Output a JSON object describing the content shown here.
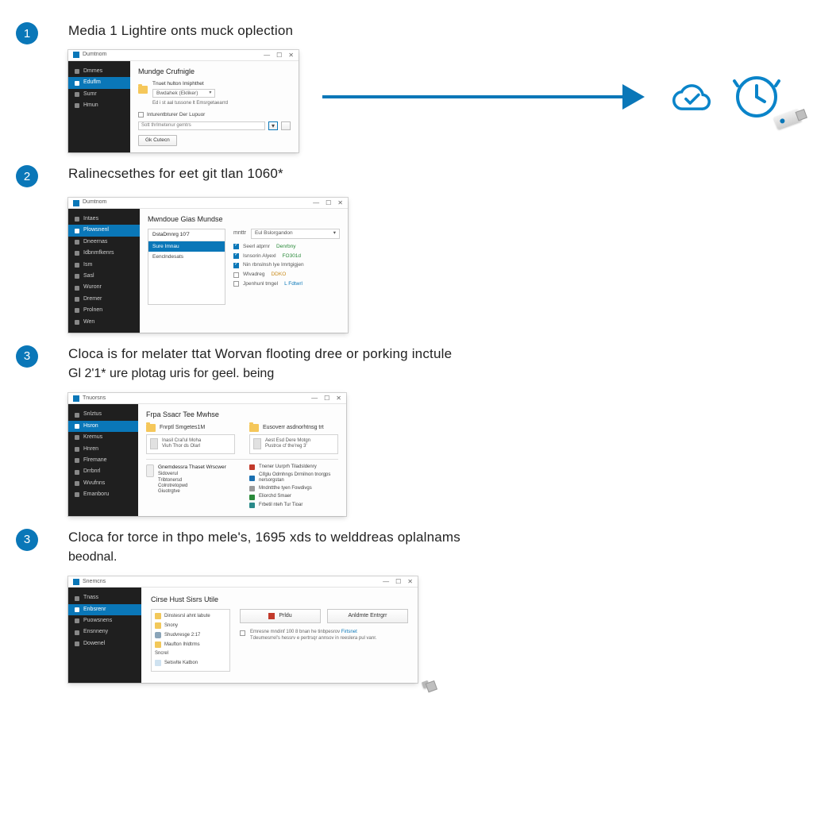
{
  "colors": {
    "accent": "#0a77b8"
  },
  "steps": [
    {
      "num": "1",
      "title": "Media 1 Lightire onts muck oplection"
    },
    {
      "num": "2",
      "title": "Ralinecsethes for eet git tlan 1060*"
    },
    {
      "num": "3",
      "title": "Cloca is for melater ttat Worvan flooting dree or porking inctule",
      "sub": "Gl 2'1* ure plotag uris for geel. being"
    },
    {
      "num": "3",
      "title": "Cloca for torce in thpo mele's, 1695 xds to welddreas oplalnams",
      "sub": "beodnal."
    }
  ],
  "win1": {
    "title": "Dumtnom",
    "sidebar": [
      "Dmmes",
      "Eduflm",
      "Sumr",
      "Hmun"
    ],
    "active_idx": 1,
    "header": "Mundge Crufnigle",
    "folder_label": "Tnuet hulton Imiphthet",
    "folder_path": "Bwdahek (Ekliker)",
    "caption": "Ed i st aal tussone lt Emsrgetaearrd",
    "checkbox": "Inturentbturer Der Lupuor",
    "field_text": "Sott thrlmetenur gemtrs",
    "btn": "Gk Cutecn"
  },
  "win2": {
    "title": "Dumtnom",
    "sidebar": [
      "Intaes",
      "Plowsnenl",
      "Dneernas",
      "Idbnmfkenrs",
      "Ism",
      "Sasl",
      "Wuronr",
      "Dremer",
      "Prolnen",
      "Wen"
    ],
    "active_idx": 1,
    "header": "Mwndoue Gias Mundse",
    "list_head": "DstaDmnrg 10'7",
    "list": [
      "Sure Imnau",
      "Eenclndesats"
    ],
    "sel_idx": 0,
    "filter_label": "mnttr",
    "filter_value": "Eul Bslorgandon",
    "opts": [
      {
        "on": true,
        "lbl": "Seerl atprnr",
        "val": "Denrbny",
        "cls": "g"
      },
      {
        "on": true,
        "lbl": "Isnsorin Alyexl",
        "val": "FO301d",
        "cls": "g"
      },
      {
        "on": true,
        "lbl": "Nin rbnslnsh lye Imrtgigjen",
        "val": "",
        "cls": ""
      },
      {
        "on": false,
        "lbl": "Wlvadreg",
        "val": "DDKO",
        "cls": "o"
      },
      {
        "on": false,
        "lbl": "Jpenhunl tmgel",
        "val": "L Fdtwrl",
        "cls": "b"
      }
    ]
  },
  "win3": {
    "title": "Tnuorsns",
    "sidebar": [
      "Snlztus",
      "Hsron",
      "Kremus",
      "Hnren",
      "Flremane",
      "Drrbnrl",
      "Wvufnns",
      "Emanboru"
    ],
    "active_idx": 1,
    "header": "Frpa Ssacr Tee Mwhse",
    "card1": {
      "head": "Fnrptl Smgetes1M",
      "l1": "Inasil Cral'ul Moha",
      "l2": "Viuh Thor ds Olarl"
    },
    "card2": {
      "head": "Eusoverr asdnorhtnsg trt",
      "l1": "Aest Esd Dere Motgn",
      "l2": "Pustrce cf the'reg 3'"
    },
    "left_head": "Gnemdessra Thaset Wrscwer",
    "left_list": [
      "Sidoverul",
      "Tribtonersd",
      "Colrotretopwd",
      "Giuotrgtve"
    ],
    "right_list": [
      {
        "cls": "d-red",
        "txt": "Tnener Uurprh Tiladsldenry"
      },
      {
        "cls": "d-blue",
        "txt": "Cifglu Odmhngs Drmilnon tnorgps nersorgstan"
      },
      {
        "cls": "d-grey",
        "txt": "Mndnttthe tyen Fowdivgs"
      },
      {
        "cls": "d-green",
        "txt": "Eliorchd Smaer"
      },
      {
        "cls": "d-teal",
        "txt": "Frbetil nteh Tur Tioar"
      }
    ]
  },
  "win4": {
    "title": "Snemcns",
    "sidebar": [
      "Tnass",
      "Enbsrenr",
      "Puowsnens",
      "Ensnneny",
      "Dowenel"
    ],
    "active_idx": 1,
    "header": "Cirse Hust Sisrs Utile",
    "tree": [
      {
        "ico": "tico",
        "txt": "Dinstesrsl ahnt labute"
      },
      {
        "ico": "tico",
        "txt": "Snony"
      },
      {
        "ico": "tico hd",
        "txt": "Shudvresge 2:17"
      },
      {
        "ico": "tico",
        "txt": "Maufton Ihldtrms"
      },
      {
        "ico": "tico usb",
        "txt": "Sncrel"
      },
      {
        "ico": "tico doc",
        "txt": "Setsvlte Katbon"
      }
    ],
    "btn1": "Prldu",
    "btn2": "Anldmte Entrgrr",
    "note1": "Emresne mndinf 100 8 bnan he tinbpesrov ",
    "note_link": "Firtsnet",
    "note2": "Tdeumesrrel's hessrv e pertrsqr annsov in reeslera pul vanr."
  }
}
